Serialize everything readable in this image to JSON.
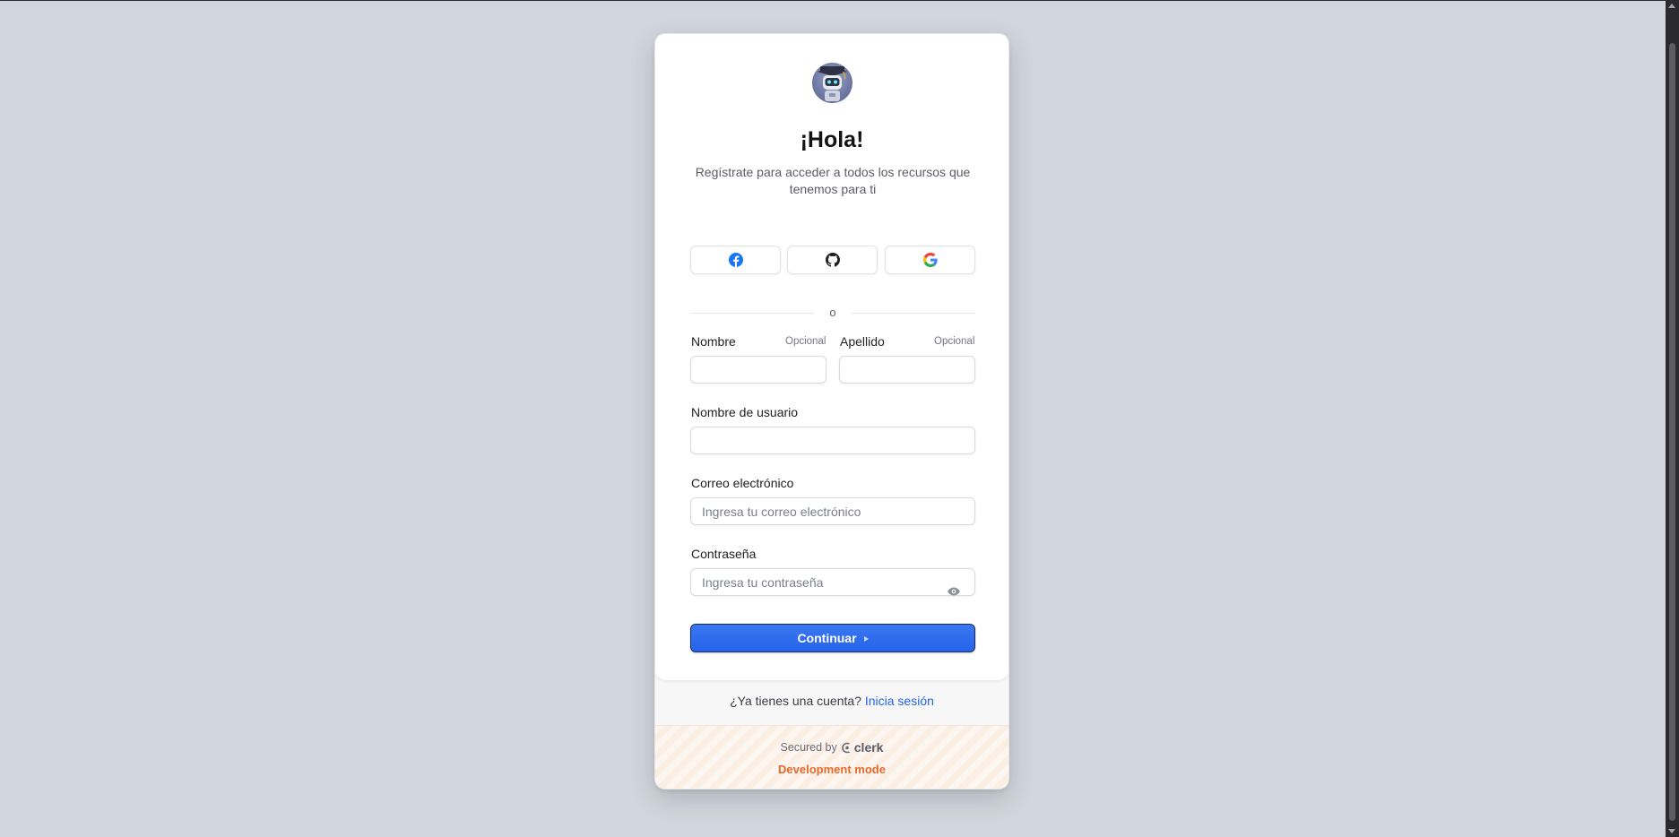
{
  "header": {
    "title": "¡Hola!",
    "subtitle": "Regístrate para acceder a todos los recursos que tenemos para ti"
  },
  "social": {
    "buttons": [
      {
        "provider": "facebook",
        "icon": "facebook-icon"
      },
      {
        "provider": "github",
        "icon": "github-icon"
      },
      {
        "provider": "google",
        "icon": "google-icon"
      }
    ]
  },
  "divider": {
    "text": "o"
  },
  "form": {
    "first_name": {
      "label": "Nombre",
      "optional": "Opcional",
      "value": "",
      "placeholder": ""
    },
    "last_name": {
      "label": "Apellido",
      "optional": "Opcional",
      "value": "",
      "placeholder": ""
    },
    "username": {
      "label": "Nombre de usuario",
      "value": "",
      "placeholder": ""
    },
    "email": {
      "label": "Correo electrónico",
      "value": "",
      "placeholder": "Ingresa tu correo electrónico"
    },
    "password": {
      "label": "Contraseña",
      "value": "",
      "placeholder": "Ingresa tu contraseña",
      "toggle_icon": "eye-icon"
    },
    "submit_label": "Continuar"
  },
  "footer": {
    "signin_prompt": "¿Ya tienes una cuenta?",
    "signin_link": "Inicia sesión",
    "secured_by": "Secured by",
    "clerk_brand": "clerk",
    "dev_mode": "Development mode"
  },
  "colors": {
    "background": "#d1d5dd",
    "primary": "#2563eb",
    "dev_mode": "#e8692a"
  }
}
